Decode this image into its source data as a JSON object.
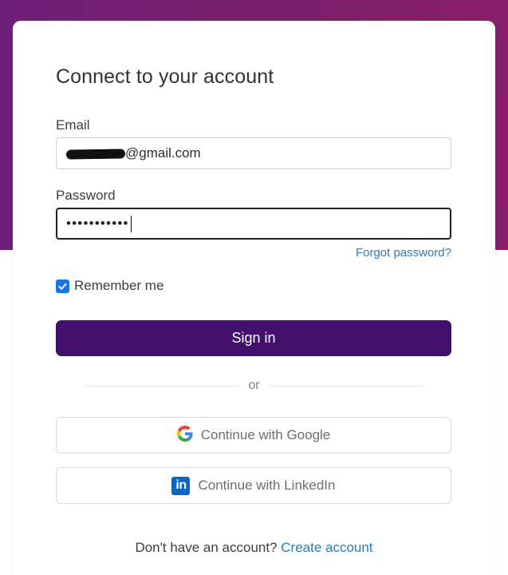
{
  "title": "Connect to your account",
  "email": {
    "label": "Email",
    "value_visible_suffix": "@gmail.com"
  },
  "password": {
    "label": "Password",
    "masked_value": "•••••••••••"
  },
  "forgot_password": "Forgot password?",
  "remember_me": {
    "label": "Remember me",
    "checked": true
  },
  "sign_in_button": "Sign in",
  "divider_text": "or",
  "google_button": "Continue with Google",
  "linkedin_button": "Continue with LinkedIn",
  "footer": {
    "prompt": "Don't have an account?",
    "link": "Create account"
  },
  "colors": {
    "background_band": "#7a1f6a",
    "primary_button": "#43106e",
    "link": "#2b7bb9",
    "checkbox": "#1a73e8",
    "linkedin": "#0a66c2"
  },
  "icons": {
    "google": "google-g-icon",
    "linkedin": "linkedin-icon",
    "checkbox": "checkmark-icon"
  }
}
